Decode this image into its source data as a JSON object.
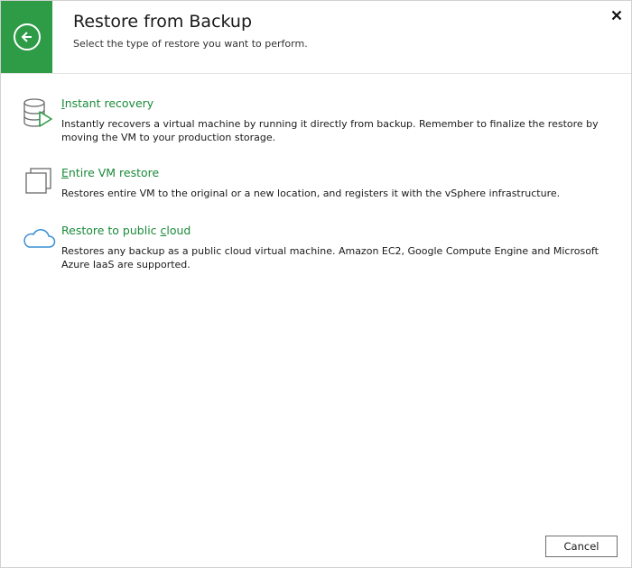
{
  "window": {
    "title": "Restore from Backup",
    "subtitle": "Select the type of restore you want to perform."
  },
  "options": [
    {
      "title_mnemonic": "I",
      "title_rest": "nstant recovery",
      "description": "Instantly recovers a virtual machine by running it directly from backup. Remember to finalize the restore by moving the VM to your production storage.",
      "icon": "database-play-icon"
    },
    {
      "title_mnemonic": "E",
      "title_rest": "ntire VM restore",
      "description": "Restores entire VM to the original or a new location, and registers it with the vSphere infrastructure.",
      "icon": "vm-copy-icon"
    },
    {
      "title_before": "Restore to public ",
      "title_mnemonic": "c",
      "title_after": "loud",
      "description": "Restores any backup as a public cloud virtual machine. Amazon EC2, Google Compute Engine and Microsoft Azure IaaS are supported.",
      "icon": "cloud-icon"
    }
  ],
  "footer": {
    "cancel_label": "Cancel"
  },
  "colors": {
    "accent_green": "#2e9b47",
    "link_green": "#1b8a3a",
    "cloud_blue": "#3a8fd6"
  }
}
